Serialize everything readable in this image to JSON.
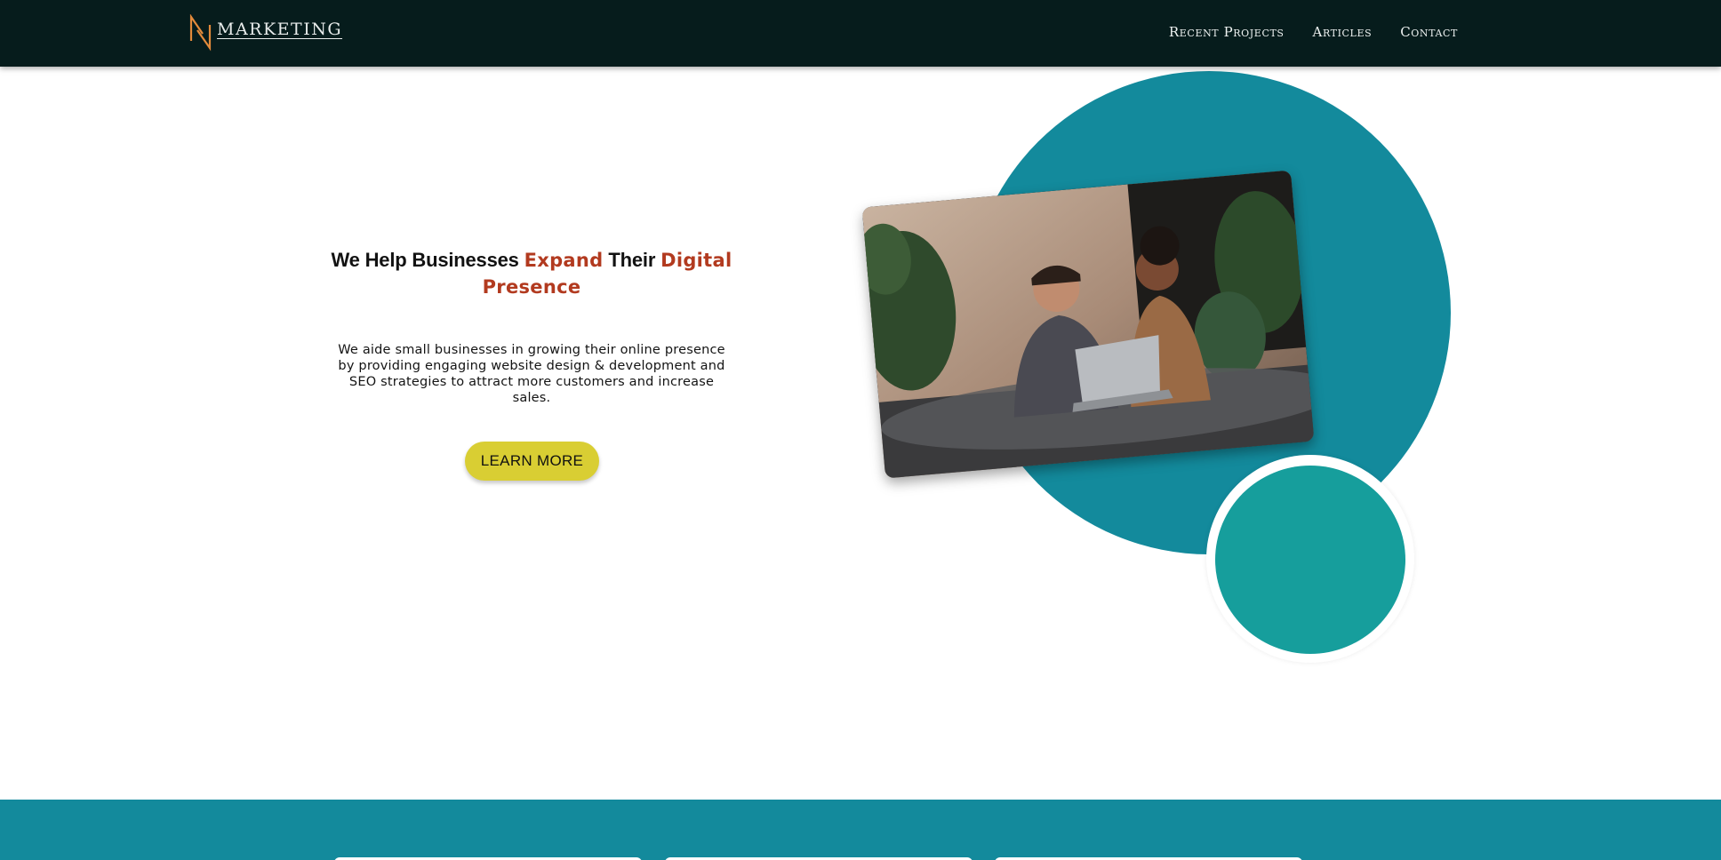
{
  "header": {
    "logo_text": "MARKETING",
    "nav": [
      {
        "label": "Recent Projects"
      },
      {
        "label": "Articles"
      },
      {
        "label": "Contact"
      }
    ]
  },
  "hero": {
    "title_part1": "We Help Businesses ",
    "title_accent1": "Expand",
    "title_part2": " Their ",
    "title_accent2": "Digital Presence",
    "description": "We aide small businesses in growing their online presence by providing engaging website design & development and SEO strategies to attract more customers and increase sales.",
    "button_label": "LEARN MORE"
  },
  "colors": {
    "header_bg": "#061c1c",
    "accent_text": "#b23a1f",
    "button_bg": "#d9ce33",
    "teal_primary": "#138a9c",
    "teal_secondary": "#169e9c",
    "logo_mark": "#e28a3b"
  },
  "icons": {
    "logo_mark": "n-monogram-logo-icon"
  }
}
